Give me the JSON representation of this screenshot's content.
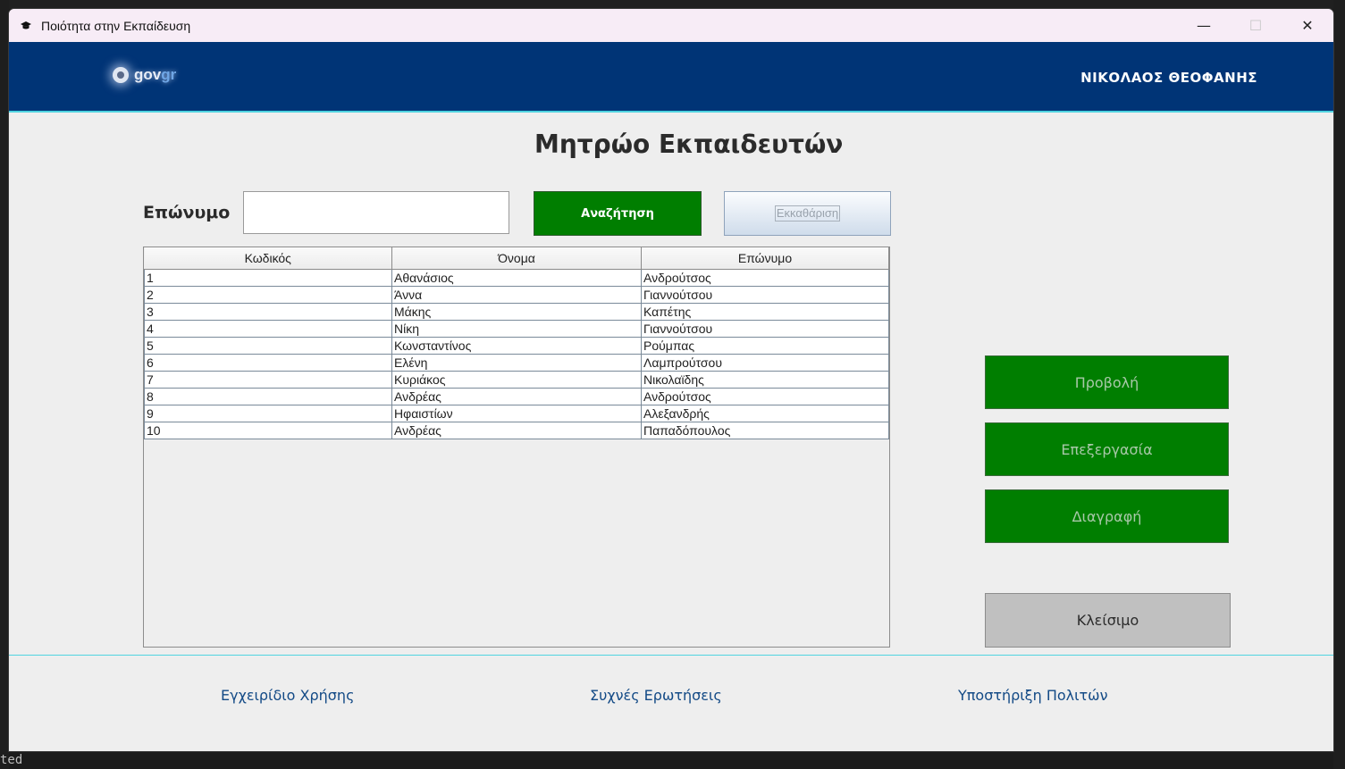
{
  "window": {
    "title": "Ποιότητα στην Εκπαίδευση",
    "minimize": "—",
    "maximize": "☐",
    "close": "✕"
  },
  "header": {
    "logo_text_gov": "gov",
    "logo_text_gr": "gr",
    "user_name": "ΝΙΚΟΛΑΟΣ ΘΕΟΦΑΝΗΣ"
  },
  "page": {
    "title": "Μητρώο Εκπαιδευτών"
  },
  "search": {
    "label": "Επώνυμο",
    "value": "",
    "search_button": "Αναζήτηση",
    "clear_button": "Εκκαθάριση"
  },
  "table": {
    "columns": [
      "Κωδικός",
      "Όνομα",
      "Επώνυμο"
    ],
    "rows": [
      [
        "1",
        "Αθανάσιος",
        "Ανδρούτσος"
      ],
      [
        "2",
        "Άννα",
        "Γιαννούτσου"
      ],
      [
        "3",
        "Μάκης",
        "Καπέτης"
      ],
      [
        "4",
        "Νίκη",
        "Γιαννούτσου"
      ],
      [
        "5",
        "Κωνσταντίνος",
        "Ρούμπας"
      ],
      [
        "6",
        "Ελένη",
        "Λαμπρούτσου"
      ],
      [
        "7",
        "Κυριάκος",
        "Νικολαϊδης"
      ],
      [
        "8",
        "Ανδρέας",
        "Ανδρούτσος"
      ],
      [
        "9",
        "Ηφαιστίων",
        "Αλεξανδρής"
      ],
      [
        "10",
        "Ανδρέας",
        "Παπαδόπουλος"
      ]
    ]
  },
  "actions": {
    "view": "Προβολή",
    "edit": "Επεξεργασία",
    "delete": "Διαγραφή",
    "close": "Κλείσιμο"
  },
  "footer": {
    "manual": "Εγχειρίδιο Χρήσης",
    "faq": "Συχνές Ερωτήσεις",
    "support": "Υποστήριξη Πολιτών"
  },
  "background": {
    "terminal_text": "ted"
  },
  "colors": {
    "header_bg": "#003476",
    "accent_line": "#4fd3e0",
    "button_green": "#007e00",
    "footer_link": "#134a86"
  }
}
